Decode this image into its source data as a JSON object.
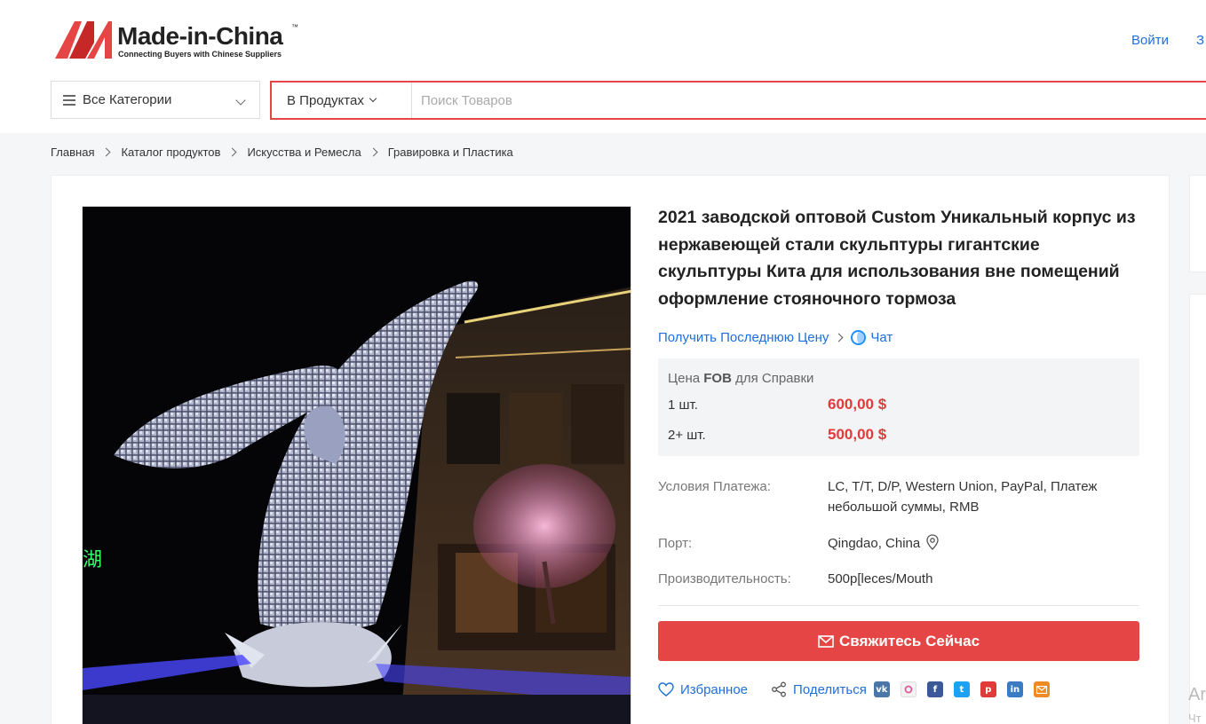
{
  "header": {
    "logo_name": "Made-in-China",
    "logo_tm": "™",
    "logo_tagline": "Connecting Buyers with Chinese Suppliers",
    "login_label": "Войти",
    "register_label_partial": "З"
  },
  "search": {
    "category_label": "Все Категории",
    "scope_label": "В Продуктах",
    "placeholder": "Поиск Товаров"
  },
  "breadcrumb": [
    "Главная",
    "Каталог продуктов",
    "Искусства и Ремесла",
    "Гравировка и Пластика"
  ],
  "product": {
    "title": "2021 заводской оптовой Custom Уникальный корпус из нержавеющей стали скульптуры гигантские скульптуры Кита для использования вне помещений оформление стояночного тормоза",
    "latest_price_link": "Получить Последнюю Цену",
    "chat_label": "Чат",
    "price_header_pre": "Цена",
    "price_header_bold": "FOB",
    "price_header_post": "для Справки",
    "prices": [
      {
        "qty": "1 шт.",
        "price": "600,00 $"
      },
      {
        "qty": "2+ шт.",
        "price": "500,00 $"
      }
    ],
    "payment_label": "Условия Платежа:",
    "payment_value": "LC, T/T, D/P, Western Union, PayPal, Платеж небольшой суммы, RMB",
    "port_label": "Порт:",
    "port_value": "Qingdao, China",
    "capacity_label": "Производительность:",
    "capacity_value": "500p[leces/Mouth",
    "contact_label": "Свяжитесь Сейчас",
    "favorite_label": "Избранное",
    "share_label": "Поделиться"
  },
  "side": {
    "text1": "Ar",
    "text2": "Чт"
  },
  "colors": {
    "brand_red": "#e64545",
    "link_blue": "#1e6fd9",
    "price_red": "#e03a3a"
  },
  "social_icons": [
    "vk-icon",
    "odnoklassniki-icon",
    "facebook-icon",
    "twitter-icon",
    "pinterest-icon",
    "linkedin-icon",
    "email-icon"
  ]
}
